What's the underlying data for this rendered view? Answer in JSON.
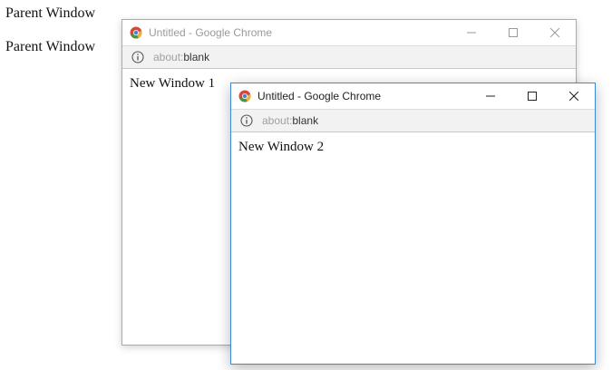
{
  "parent": {
    "lines": [
      "Parent Window",
      "Parent Window"
    ]
  },
  "windows": [
    {
      "title": "Untitled - Google Chrome",
      "url_scheme": "about:",
      "url_rest": "blank",
      "content": "New Window 1",
      "active": false
    },
    {
      "title": "Untitled - Google Chrome",
      "url_scheme": "about:",
      "url_rest": "blank",
      "content": "New Window 2",
      "active": true
    }
  ],
  "icons": {
    "app": "chrome-icon",
    "info": "info-icon",
    "minimize": "minimize-icon",
    "maximize": "maximize-icon",
    "close": "close-icon"
  },
  "colors": {
    "active_border": "#3c8ad4",
    "inactive_border": "#aaaaaa",
    "inactive_title_text": "#999999"
  }
}
